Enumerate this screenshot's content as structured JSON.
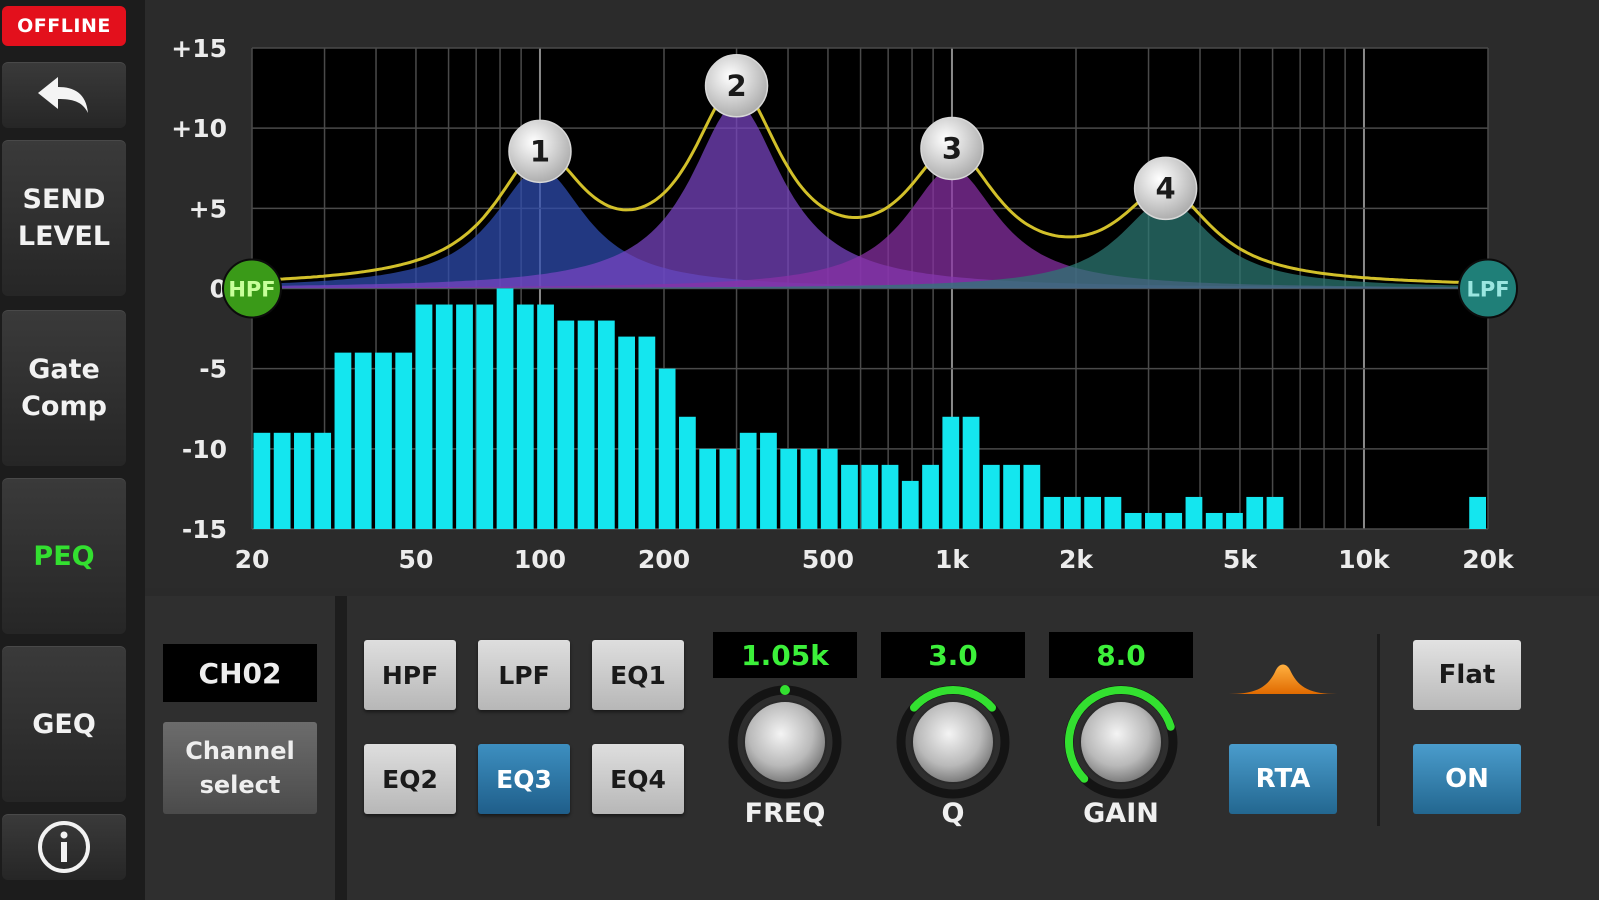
{
  "sidebar": {
    "status_badge": "OFFLINE",
    "items": [
      {
        "label": "SEND\nLEVEL"
      },
      {
        "label": "Gate\nComp"
      },
      {
        "label": "PEQ",
        "active": true
      },
      {
        "label": "GEQ"
      }
    ]
  },
  "icons": {
    "back": "back-arrow-icon",
    "info": "info-icon",
    "filter_shape": "bell-filter-shape-icon"
  },
  "colors": {
    "active_accent": "#33e030",
    "rta_bars": "#14e6ef",
    "curve": "#d2c02a",
    "band1": "#2f4db3",
    "band2": "#7a45c4",
    "band3": "#8b31a6",
    "band4": "#2d7a74",
    "hpf": "#3a9a18",
    "lpf": "#1f7f78",
    "offline": "#e3101c"
  },
  "chart_data": {
    "type": "parametric-eq",
    "x_scale": "log",
    "xlim": [
      20,
      20000
    ],
    "ylim": [
      -15,
      15
    ],
    "x_ticks": [
      "20",
      "50",
      "100",
      "200",
      "500",
      "1k",
      "2k",
      "5k",
      "10k",
      "20k"
    ],
    "y_ticks": [
      "+15",
      "+10",
      "+5",
      "0",
      "-5",
      "-10",
      "-15"
    ],
    "bands": [
      {
        "id": "1",
        "freq": 100,
        "gain": 7.5
      },
      {
        "id": "2",
        "freq": 300,
        "gain": 11.5
      },
      {
        "id": "3",
        "freq": 1000,
        "gain": 7.5
      },
      {
        "id": "4",
        "freq": 3300,
        "gain": 5.5
      }
    ],
    "hpf": {
      "label": "HPF",
      "freq": 20,
      "gain": 0
    },
    "lpf": {
      "label": "LPF",
      "freq": 20000,
      "gain": 0
    },
    "rta": {
      "freqs": [
        20,
        22.4,
        25,
        28,
        31.5,
        35.5,
        40,
        45,
        50,
        56,
        63,
        71,
        80,
        90,
        100,
        112,
        125,
        140,
        160,
        180,
        200,
        224,
        250,
        280,
        315,
        355,
        400,
        450,
        500,
        560,
        630,
        710,
        800,
        900,
        1000,
        1120,
        1250,
        1400,
        1600,
        1800,
        2000,
        2240,
        2500,
        2800,
        3150,
        3550,
        4000,
        4500,
        5000,
        5600,
        6300,
        7100,
        8000,
        9000,
        10000,
        11200,
        12500,
        14000,
        16000,
        18000,
        20000
      ],
      "levels_db": [
        -9,
        -9,
        -9,
        -9,
        -4,
        -4,
        -4,
        -4,
        -1,
        -1,
        -1,
        -1,
        0,
        -1,
        -1,
        -2,
        -2,
        -2,
        -3,
        -3,
        -5,
        -8,
        -10,
        -10,
        -9,
        -9,
        -10,
        -10,
        -10,
        -11,
        -11,
        -11,
        -12,
        -11,
        -8,
        -8,
        -11,
        -11,
        -11,
        -13,
        -13,
        -13,
        -13,
        -14,
        -14,
        -14,
        -13,
        -14,
        -14,
        -13,
        -13,
        -15,
        -15,
        -15,
        -15,
        -15,
        -15,
        -15,
        -15,
        -15,
        -13
      ]
    }
  },
  "channel": {
    "display": "CH02",
    "select_label": "Channel\nselect"
  },
  "band_buttons": [
    "HPF",
    "LPF",
    "EQ1",
    "EQ2",
    "EQ3",
    "EQ4"
  ],
  "active_band": "EQ3",
  "knobs": [
    {
      "name": "FREQ",
      "value": "1.05k",
      "level": 0.5
    },
    {
      "name": "Q",
      "value": "3.0",
      "level": 0.42
    },
    {
      "name": "GAIN",
      "value": "8.0",
      "level": 0.77
    }
  ],
  "controls": {
    "flat": "Flat",
    "rta": "RTA",
    "on": "ON"
  }
}
